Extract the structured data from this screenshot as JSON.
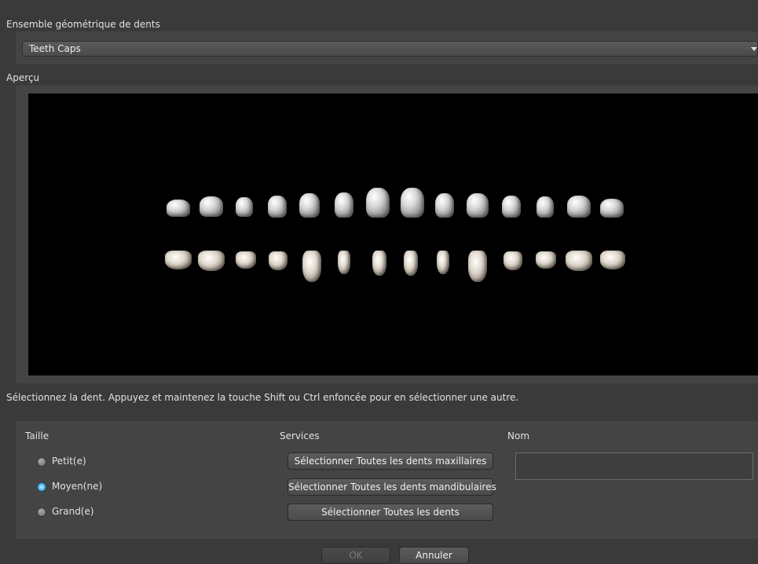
{
  "geometry_set": {
    "label": "Ensemble géométrique de dents",
    "selected": "Teeth Caps"
  },
  "preview": {
    "label": "Aperçu"
  },
  "hint": "Sélectionnez la dent. Appuyez et maintenez la touche Shift ou Ctrl enfoncée pour en sélectionner une autre.",
  "size": {
    "label": "Taille",
    "options": [
      {
        "label": "Petit(e)",
        "selected": false
      },
      {
        "label": "Moyen(ne)",
        "selected": true
      },
      {
        "label": "Grand(e)",
        "selected": false
      }
    ]
  },
  "services": {
    "label": "Services",
    "buttons": [
      "Sélectionner Toutes les dents maxillaires",
      "Sélectionner Toutes les dents mandibulaires",
      "Sélectionner Toutes les dents"
    ]
  },
  "name": {
    "label": "Nom",
    "value": ""
  },
  "footer": {
    "ok": "OK",
    "cancel": "Annuler"
  }
}
